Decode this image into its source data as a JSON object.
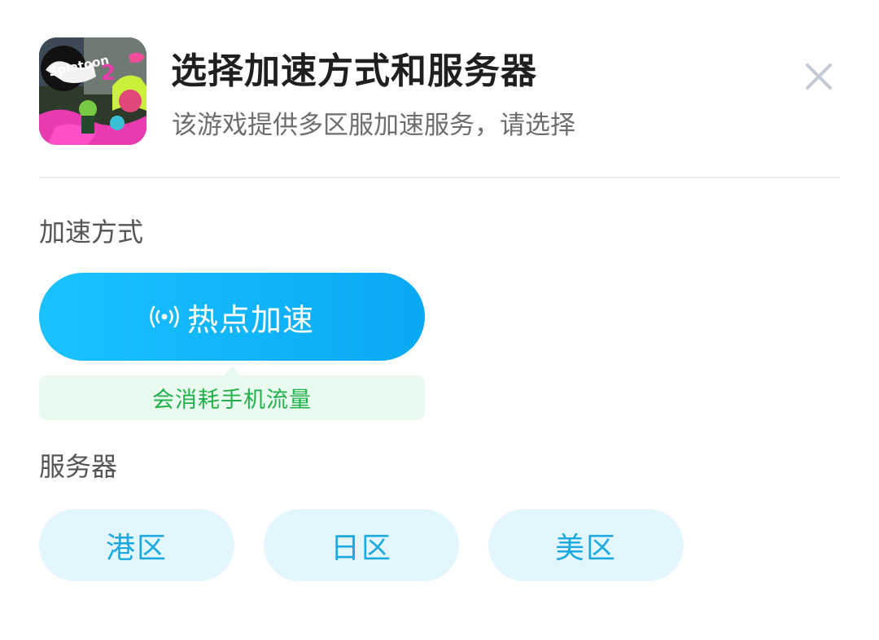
{
  "header": {
    "title": "选择加速方式和服务器",
    "subtitle": "该游戏提供多区服加速服务，请选择",
    "game_icon": "splatoon-2-cover",
    "close_icon": "close-icon"
  },
  "acceleration": {
    "section_label": "加速方式",
    "mode_label": "热点加速",
    "mode_icon": "hotspot-icon",
    "tip": "会消耗手机流量"
  },
  "servers": {
    "section_label": "服务器",
    "items": [
      {
        "label": "港区"
      },
      {
        "label": "日区"
      },
      {
        "label": "美区"
      }
    ]
  },
  "colors": {
    "primary": "#0aa9f2",
    "tip_green": "#22b04d",
    "server_text": "#1ba9e0",
    "server_bg": "#e4f6fd"
  }
}
